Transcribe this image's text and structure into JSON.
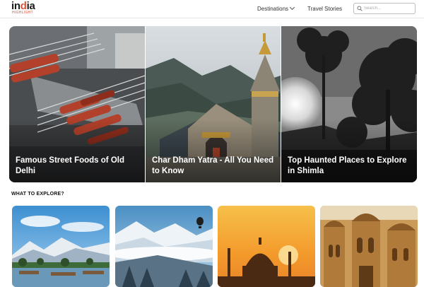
{
  "header": {
    "logo": {
      "word_start": "in",
      "word_mid": "d",
      "word_end": "ia",
      "tagline": "HIGHLIGHT"
    },
    "nav": {
      "destinations": "Destinations",
      "travel_stories": "Travel Stories"
    },
    "search": {
      "placeholder": "Search..."
    }
  },
  "hero": {
    "cards": [
      {
        "title": "Famous Street Foods of Old Delhi"
      },
      {
        "title": "Char Dham Yatra - All You Need to Know"
      },
      {
        "title": "Top Haunted Places to Explore in Shimla"
      }
    ]
  },
  "explore": {
    "heading": "WHAT TO EXPLORE?",
    "tiles": [
      {
        "icon": "kashmir-lake-image"
      },
      {
        "icon": "snow-valley-balloon-image"
      },
      {
        "icon": "taj-mahal-sunset-image"
      },
      {
        "icon": "rajasthan-fort-image"
      }
    ]
  },
  "colors": {
    "accent": "#e0533b",
    "text": "#222222",
    "border": "#e7e7e7"
  }
}
